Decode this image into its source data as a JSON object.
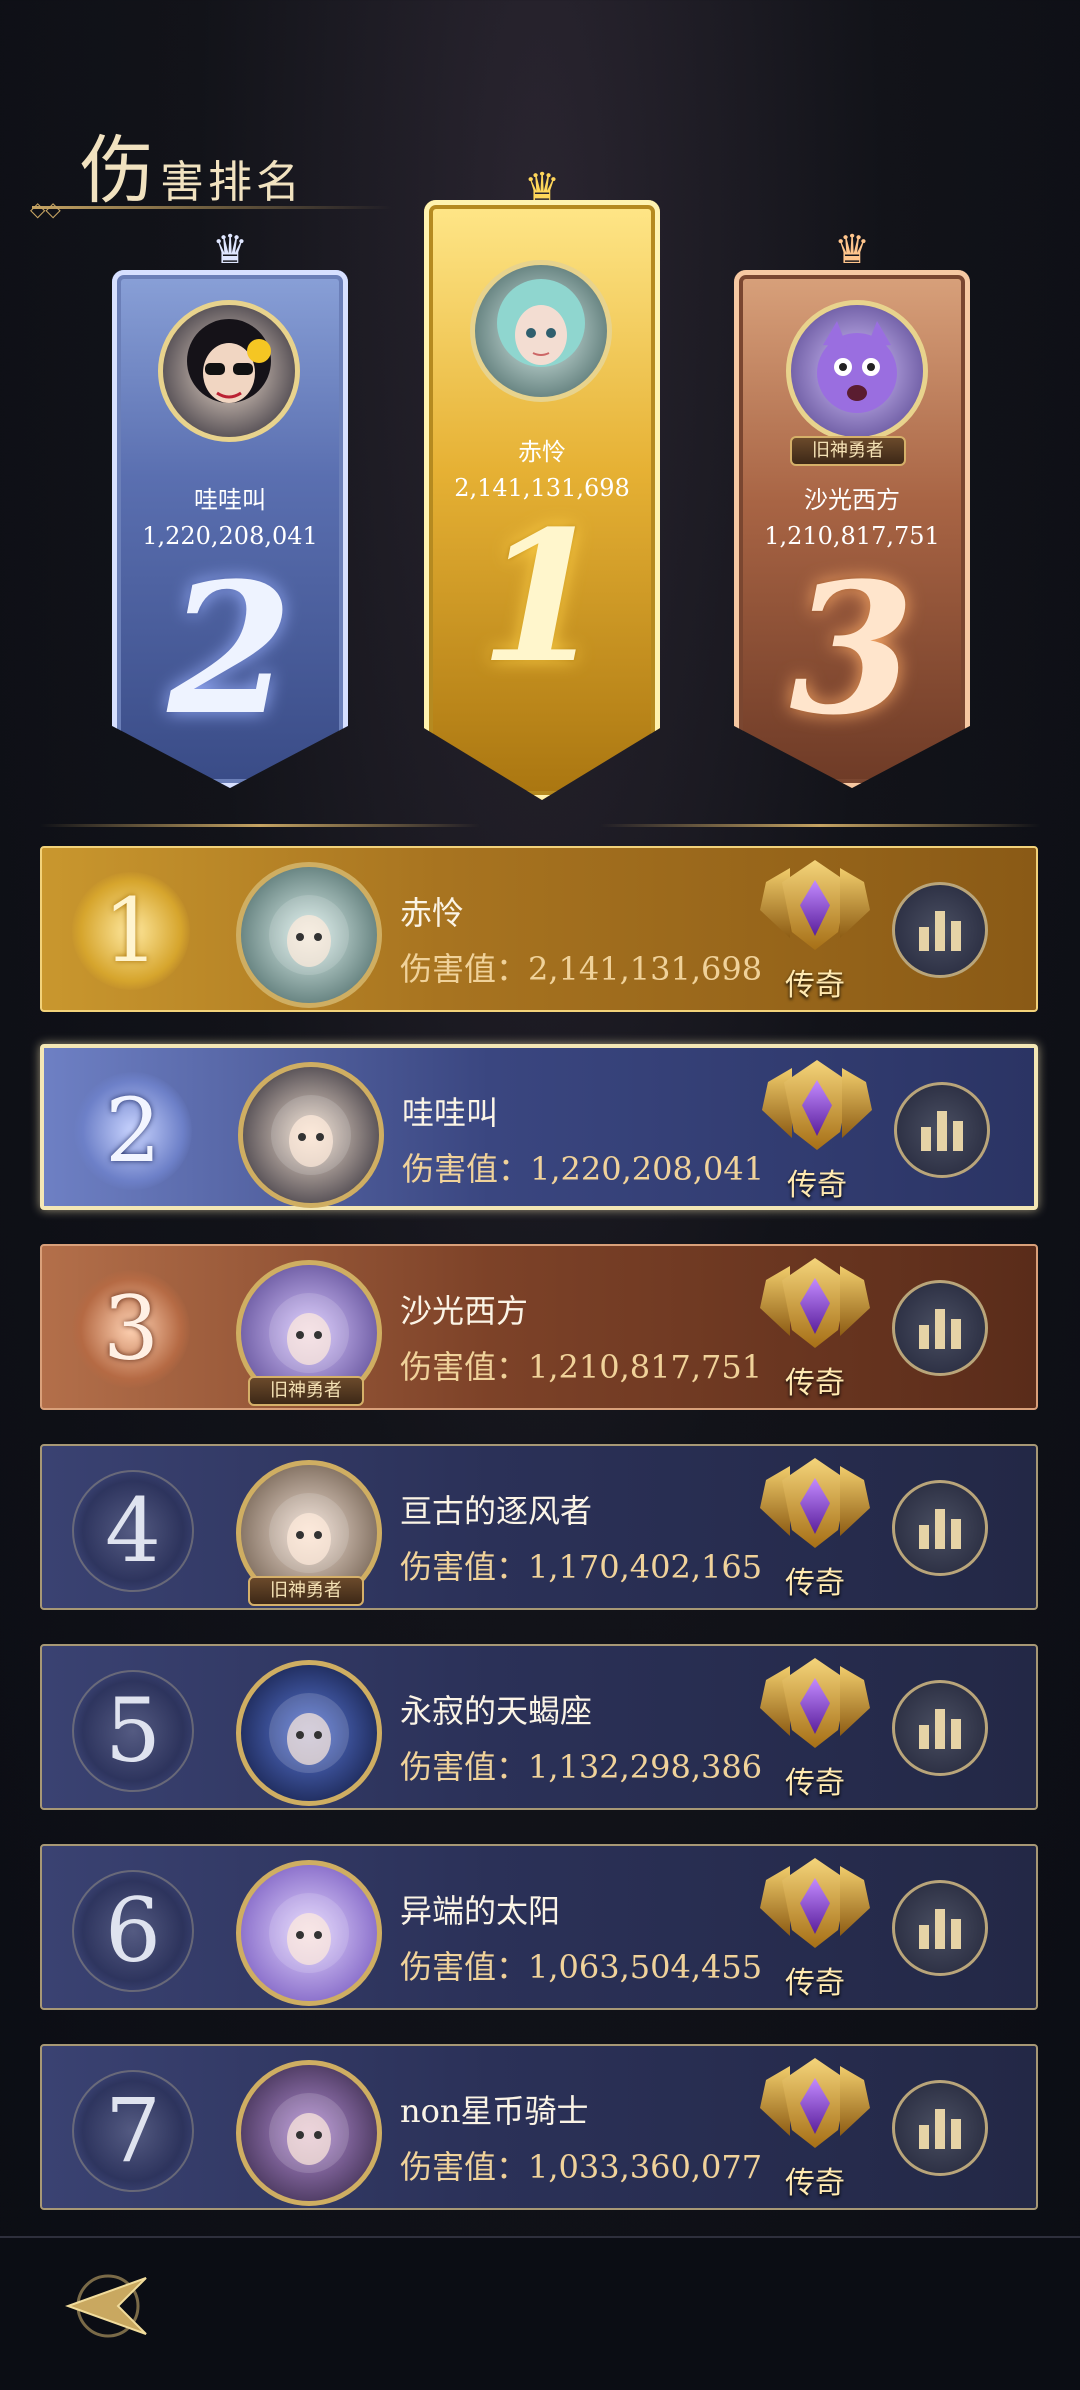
{
  "title": {
    "first_char": "伤",
    "rest": "害排名"
  },
  "podium": [
    {
      "rank": "2",
      "name": "哇哇叫",
      "score": "1,220,208,041",
      "tag": ""
    },
    {
      "rank": "1",
      "name": "赤怜",
      "score": "2,141,131,698",
      "tag": ""
    },
    {
      "rank": "3",
      "name": "沙光西方",
      "score": "1,210,817,751",
      "tag": "旧神勇者"
    }
  ],
  "rows": [
    {
      "rank": "1",
      "name": "赤怜",
      "score": "伤害值：2,141,131,698",
      "badge": "传奇",
      "tag": ""
    },
    {
      "rank": "2",
      "name": "哇哇叫",
      "score": "伤害值：1,220,208,041",
      "badge": "传奇",
      "tag": ""
    },
    {
      "rank": "3",
      "name": "沙光西方",
      "score": "伤害值：1,210,817,751",
      "badge": "传奇",
      "tag": "旧神勇者"
    },
    {
      "rank": "4",
      "name": "亘古的逐风者",
      "score": "伤害值：1,170,402,165",
      "badge": "传奇",
      "tag": "旧神勇者"
    },
    {
      "rank": "5",
      "name": "永寂的天蝎座",
      "score": "伤害值：1,132,298,386",
      "badge": "传奇",
      "tag": ""
    },
    {
      "rank": "6",
      "name": "异端的太阳",
      "score": "伤害值：1,063,504,455",
      "badge": "传奇",
      "tag": ""
    },
    {
      "rank": "7",
      "name": "non星币骑士",
      "score": "伤害值：1,033,360,077",
      "badge": "传奇",
      "tag": ""
    }
  ],
  "icons": {
    "stats": "bar-chart-icon",
    "back": "back-arrow-icon",
    "badge": "legend-badge-icon"
  },
  "colors": {
    "gold": "#d6a52d",
    "silver": "#6d80c8",
    "bronze": "#b56a44",
    "accent": "#c6a463"
  }
}
